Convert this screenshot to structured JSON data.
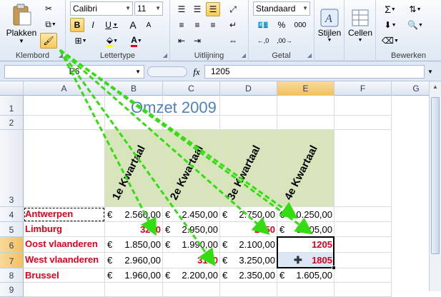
{
  "ribbon": {
    "clipboard": {
      "paste_label": "Plakken",
      "group_label": "Klembord"
    },
    "font": {
      "name": "Calibri",
      "size": "11",
      "group_label": "Lettertype",
      "bold": "B",
      "italic": "I",
      "underline": "U",
      "grow": "A",
      "shrink": "A",
      "font_color_glyph": "A"
    },
    "alignment": {
      "group_label": "Uitlijning"
    },
    "number": {
      "format": "Standaard",
      "group_label": "Getal",
      "percent": "%",
      "thousands": "000"
    },
    "styles": {
      "label": "Stijlen"
    },
    "cells": {
      "label": "Cellen"
    },
    "editing": {
      "group_label": "Bewerken",
      "sum": "Σ"
    }
  },
  "formula_bar": {
    "name_box": "E6",
    "fx": "fx",
    "value": "1205"
  },
  "columns": [
    "A",
    "B",
    "C",
    "D",
    "E",
    "F",
    "G"
  ],
  "rows": [
    "1",
    "2",
    "3",
    "4",
    "5",
    "6",
    "7",
    "8",
    "9"
  ],
  "sheet": {
    "title": "Omzet 2009",
    "quarter_headers": [
      "1e Kwartaal",
      "2e Kwartaal",
      "3e Kwartaal",
      "4e Kwartaal"
    ],
    "currency": "€",
    "data_rows": [
      {
        "label": "Antwerpen",
        "values": [
          "2.560,00",
          "2.450,00",
          "2.750,00",
          "10.250,00"
        ],
        "red": [
          false,
          false,
          false,
          false
        ]
      },
      {
        "label": "Limburg",
        "values": [
          "3250",
          "2.950,00",
          "2850",
          "3.805,00"
        ],
        "red": [
          true,
          false,
          true,
          false
        ]
      },
      {
        "label": "Oost vlaanderen",
        "values": [
          "1.850,00",
          "1.990,00",
          "2.100,00",
          "1205"
        ],
        "red": [
          false,
          false,
          false,
          true
        ]
      },
      {
        "label": "West vlaanderen",
        "values": [
          "2.960,00",
          "3100",
          "3.250,00",
          "1805"
        ],
        "red": [
          false,
          true,
          false,
          true
        ]
      },
      {
        "label": "Brussel",
        "values": [
          "1.960,00",
          "2.200,00",
          "2.350,00",
          "1.605,00"
        ],
        "red": [
          false,
          false,
          false,
          false
        ]
      }
    ]
  },
  "colors": {
    "accent_red": "#e0001b",
    "header_green": "#d8e4bc",
    "arrow_green": "#33dd11",
    "title_blue": "#4f81bd",
    "selection": "#000000"
  }
}
